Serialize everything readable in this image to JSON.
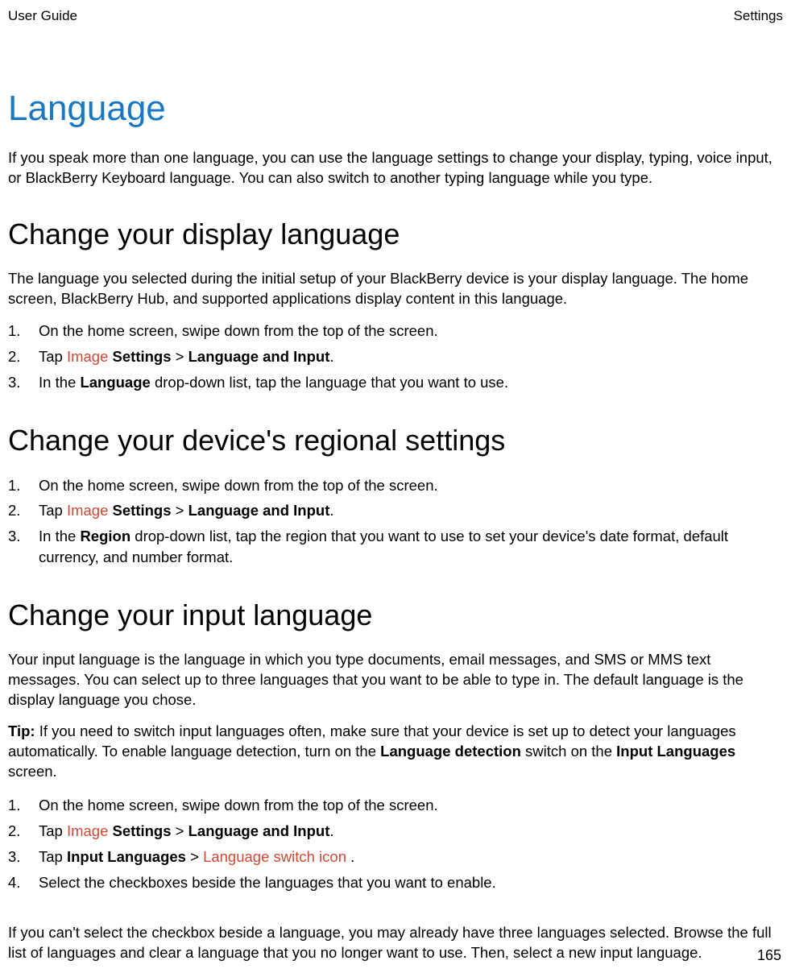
{
  "header": {
    "left": "User Guide",
    "right": "Settings"
  },
  "title": "Language",
  "intro": "If you speak more than one language, you can use the language settings to change your display, typing, voice input, or BlackBerry Keyboard language. You can also switch to another typing language while you type.",
  "section1": {
    "title": "Change your display language",
    "intro": "The language you selected during the initial setup of your BlackBerry device is your display language. The home screen, BlackBerry Hub, and supported applications display content in this language.",
    "steps": {
      "s1_num": "1.",
      "s1_text": "On the home screen, swipe down from the top of the screen.",
      "s2_num": "2.",
      "s2_tap": "Tap ",
      "s2_img": " Image ",
      "s2_settings": " Settings",
      "s2_gt": " > ",
      "s2_langinput": "Language and Input",
      "s2_period": ".",
      "s3_num": "3.",
      "s3_a": "In the ",
      "s3_b": "Language",
      "s3_c": " drop-down list, tap the language that you want to use."
    }
  },
  "section2": {
    "title": "Change your device's regional settings",
    "steps": {
      "s1_num": "1.",
      "s1_text": "On the home screen, swipe down from the top of the screen.",
      "s2_num": "2.",
      "s2_tap": "Tap ",
      "s2_img": " Image ",
      "s2_settings": " Settings",
      "s2_gt": " > ",
      "s2_langinput": "Language and Input",
      "s2_period": ".",
      "s3_num": "3.",
      "s3_a": "In the ",
      "s3_b": "Region",
      "s3_c": " drop-down list, tap the region that you want to use to set your device's date format, default currency, and number format."
    }
  },
  "section3": {
    "title": "Change your input language",
    "intro": "Your input language is the language in which you type documents, email messages, and SMS or MMS text messages. You can select up to three languages that you want to be able to type in. The default language is the display language you chose.",
    "tip_label": "Tip:",
    "tip_a": " If you need to switch input languages often, make sure that your device is set up to detect your languages automatically. To enable language detection, turn on the ",
    "tip_b": "Language detection",
    "tip_c": " switch on the ",
    "tip_d": "Input Languages",
    "tip_e": " screen.",
    "steps": {
      "s1_num": "1.",
      "s1_text": "On the home screen, swipe down from the top of the screen.",
      "s2_num": "2.",
      "s2_tap": "Tap ",
      "s2_img": " Image ",
      "s2_settings": " Settings",
      "s2_gt": " > ",
      "s2_langinput": "Language and Input",
      "s2_period": ".",
      "s3_num": "3.",
      "s3_a": "Tap ",
      "s3_b": "Input Languages",
      "s3_c": " > ",
      "s3_d": " Language switch icon ",
      "s3_e": ".",
      "s4_num": "4.",
      "s4_text": "Select the checkboxes beside the languages that you want to enable."
    },
    "closing": "If you can't select the checkbox beside a language, you may already have three languages selected. Browse the full list of languages and clear a language that you no longer want to use. Then, select a new input language."
  },
  "page_number": "165"
}
